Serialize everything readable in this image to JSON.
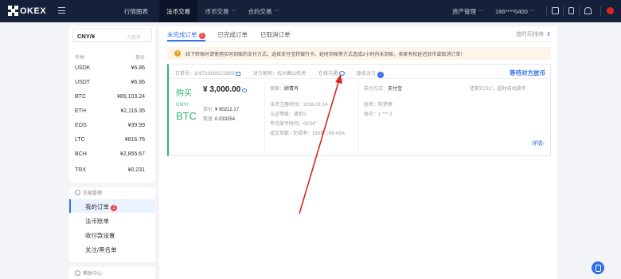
{
  "header": {
    "logo": "OKEX",
    "nav": [
      "行情图表",
      "法币交易",
      "币币交易",
      "合约交易"
    ],
    "asset_menu": "资产管理",
    "phone": "186****0400"
  },
  "sidebar": {
    "currency_value": "CNY/¥",
    "currency_placeholder": "人民币",
    "col_coin": "币种",
    "col_price": "现价",
    "coins": [
      {
        "symbol": "USDK",
        "price": "¥6.86"
      },
      {
        "symbol": "USDT",
        "price": "¥6.86"
      },
      {
        "symbol": "BTC",
        "price": "¥89,103.24"
      },
      {
        "symbol": "ETH",
        "price": "¥2,116.35"
      },
      {
        "symbol": "EOS",
        "price": "¥39.99"
      },
      {
        "symbol": "LTC",
        "price": "¥816.76"
      },
      {
        "symbol": "BCH",
        "price": "¥2,855.67"
      },
      {
        "symbol": "TRX",
        "price": "¥0.231"
      }
    ],
    "section_trade": "交易管理",
    "items": [
      "我的订单",
      "法币账单",
      "收付款设置",
      "关注/黑名单"
    ],
    "my_orders_badge": "1",
    "section_help": "帮助中心"
  },
  "main": {
    "tabs": [
      "未完成订单",
      "已完成订单",
      "已取消订单"
    ],
    "tab_badge": "1",
    "sort_label": "按时间排序",
    "notice": "线下转账时请使用实时到账的支付方式。选择支付宝转银行卡、延时到账等方式造成2小时内未到账，卖家有权延迟放币或取消订单！",
    "order": {
      "order_no_label": "订单号：",
      "order_no": "100710180121893",
      "counterparty_label": "对方昵称：",
      "counterparty": "杭州萧山机场",
      "online_label": "在线沟通",
      "contact_label": "联系对方",
      "status": "等待对方放币",
      "side": "购买",
      "amount": "¥ 3,000.00",
      "pair_top": "CNY/",
      "pair_bottom": "BTC",
      "unit_price_label": "单价",
      "unit_price": "¥ 90212.17",
      "quantity_label": "数量",
      "quantity": "0.033254",
      "seller_label": "卖家：",
      "seller": "顾青丹",
      "reg_time_label": "法币注册时间：",
      "reg_time": "2018-01-14",
      "cert_label": "认证等级：",
      "cert": "级别3",
      "avg_release_label": "平均放币时间：",
      "avg_release": "00'24\"",
      "trades_label": "成交单数 / 完成率：",
      "trades": "180单 / 99.43%",
      "pay_method_label": "支付方式：",
      "pay_method": "支付宝",
      "countdown": "还剩71'51\"，超时自动放币",
      "name_label": "姓名：",
      "name": "陈梦婷",
      "account_label": "账号：",
      "account": "1 *** 3",
      "detail_link": "详情"
    }
  },
  "colors": {
    "topbar": "#15213a",
    "accent": "#3072e8",
    "buy_green": "#2db66b",
    "annotation_red": "#d8281f"
  }
}
